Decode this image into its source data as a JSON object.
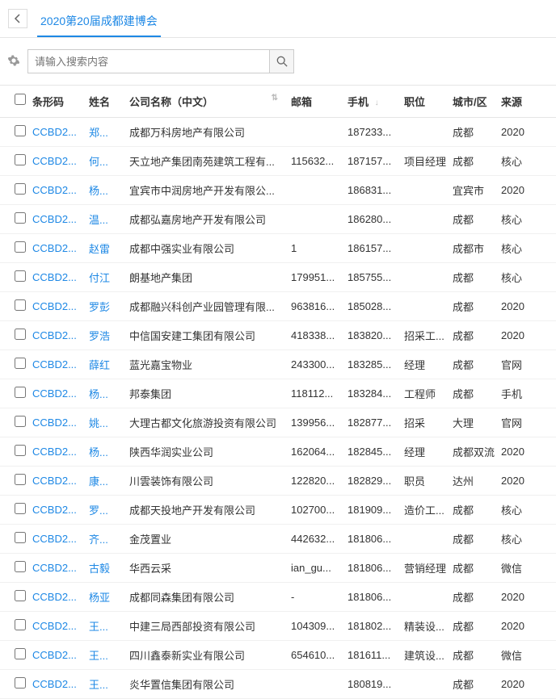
{
  "header": {
    "tab_title": "2020第20届成都建博会"
  },
  "search": {
    "placeholder": "请输入搜索内容"
  },
  "columns": {
    "barcode": "条形码",
    "name": "姓名",
    "company": "公司名称（中文）",
    "email": "邮箱",
    "phone": "手机",
    "position": "职位",
    "city": "城市/区",
    "source": "来源"
  },
  "rows": [
    {
      "barcode": "CCBD2...",
      "name": "郑...",
      "company": "成都万科房地产有限公司",
      "email": "",
      "phone": "187233...",
      "position": "",
      "city": "成都",
      "source": "2020"
    },
    {
      "barcode": "CCBD2...",
      "name": "何...",
      "company": "天立地产集团南苑建筑工程有...",
      "email": "115632...",
      "phone": "187157...",
      "position": "项目经理",
      "city": "成都",
      "source": "核心"
    },
    {
      "barcode": "CCBD2...",
      "name": "杨...",
      "company": "宜宾市中润房地产开发有限公...",
      "email": "",
      "phone": "186831...",
      "position": "",
      "city": "宜宾市",
      "source": "2020"
    },
    {
      "barcode": "CCBD2...",
      "name": "温...",
      "company": "成都弘嘉房地产开发有限公司",
      "email": "",
      "phone": "186280...",
      "position": "",
      "city": "成都",
      "source": "核心"
    },
    {
      "barcode": "CCBD2...",
      "name": "赵雷",
      "company": "成都中强实业有限公司",
      "email": "1",
      "phone": "186157...",
      "position": "",
      "city": "成都市",
      "source": "核心"
    },
    {
      "barcode": "CCBD2...",
      "name": "付江",
      "company": "朗基地产集团",
      "email": "179951...",
      "phone": "185755...",
      "position": "",
      "city": "成都",
      "source": "核心"
    },
    {
      "barcode": "CCBD2...",
      "name": "罗彭",
      "company": "成都融兴科创产业园管理有限...",
      "email": "963816...",
      "phone": "185028...",
      "position": "",
      "city": "成都",
      "source": "2020"
    },
    {
      "barcode": "CCBD2...",
      "name": "罗浩",
      "company": "中信国安建工集团有限公司",
      "email": "418338...",
      "phone": "183820...",
      "position": "招采工...",
      "city": "成都",
      "source": "2020"
    },
    {
      "barcode": "CCBD2...",
      "name": "薛红",
      "company": "蓝光嘉宝物业",
      "email": "243300...",
      "phone": "183285...",
      "position": "经理",
      "city": "成都",
      "source": "官网"
    },
    {
      "barcode": "CCBD2...",
      "name": "杨...",
      "company": "邦泰集团",
      "email": "118112...",
      "phone": "183284...",
      "position": "工程师",
      "city": "成都",
      "source": "手机"
    },
    {
      "barcode": "CCBD2...",
      "name": "姚...",
      "company": "大理古都文化旅游投资有限公司",
      "email": "139956...",
      "phone": "182877...",
      "position": "招采",
      "city": "大理",
      "source": "官网"
    },
    {
      "barcode": "CCBD2...",
      "name": "杨...",
      "company": "陕西华润实业公司",
      "email": "162064...",
      "phone": "182845...",
      "position": "经理",
      "city": "成都双流",
      "source": "2020"
    },
    {
      "barcode": "CCBD2...",
      "name": "康...",
      "company": "川雲装饰有限公司",
      "email": "122820...",
      "phone": "182829...",
      "position": "职员",
      "city": "达州",
      "source": "2020"
    },
    {
      "barcode": "CCBD2...",
      "name": "罗...",
      "company": "成都天投地产开发有限公司",
      "email": "102700...",
      "phone": "181909...",
      "position": "造价工...",
      "city": "成都",
      "source": "核心"
    },
    {
      "barcode": "CCBD2...",
      "name": "齐...",
      "company": "金茂置业",
      "email": "442632...",
      "phone": "181806...",
      "position": "",
      "city": "成都",
      "source": "核心"
    },
    {
      "barcode": "CCBD2...",
      "name": "古毅",
      "company": "华西云采",
      "email": "ian_gu...",
      "phone": "181806...",
      "position": "营销经理",
      "city": "成都",
      "source": "微信"
    },
    {
      "barcode": "CCBD2...",
      "name": "杨亚",
      "company": "成都同森集团有限公司",
      "email": "-",
      "phone": "181806...",
      "position": "",
      "city": "成都",
      "source": "2020"
    },
    {
      "barcode": "CCBD2...",
      "name": "王...",
      "company": "中建三局西部投资有限公司",
      "email": "104309...",
      "phone": "181802...",
      "position": "精装设...",
      "city": "成都",
      "source": "2020"
    },
    {
      "barcode": "CCBD2...",
      "name": "王...",
      "company": "四川鑫泰新实业有限公司",
      "email": "654610...",
      "phone": "181611...",
      "position": "建筑设...",
      "city": "成都",
      "source": "微信"
    },
    {
      "barcode": "CCBD2...",
      "name": "王...",
      "company": "炎华置信集团有限公司",
      "email": "",
      "phone": "180819...",
      "position": "",
      "city": "成都",
      "source": "2020"
    }
  ]
}
